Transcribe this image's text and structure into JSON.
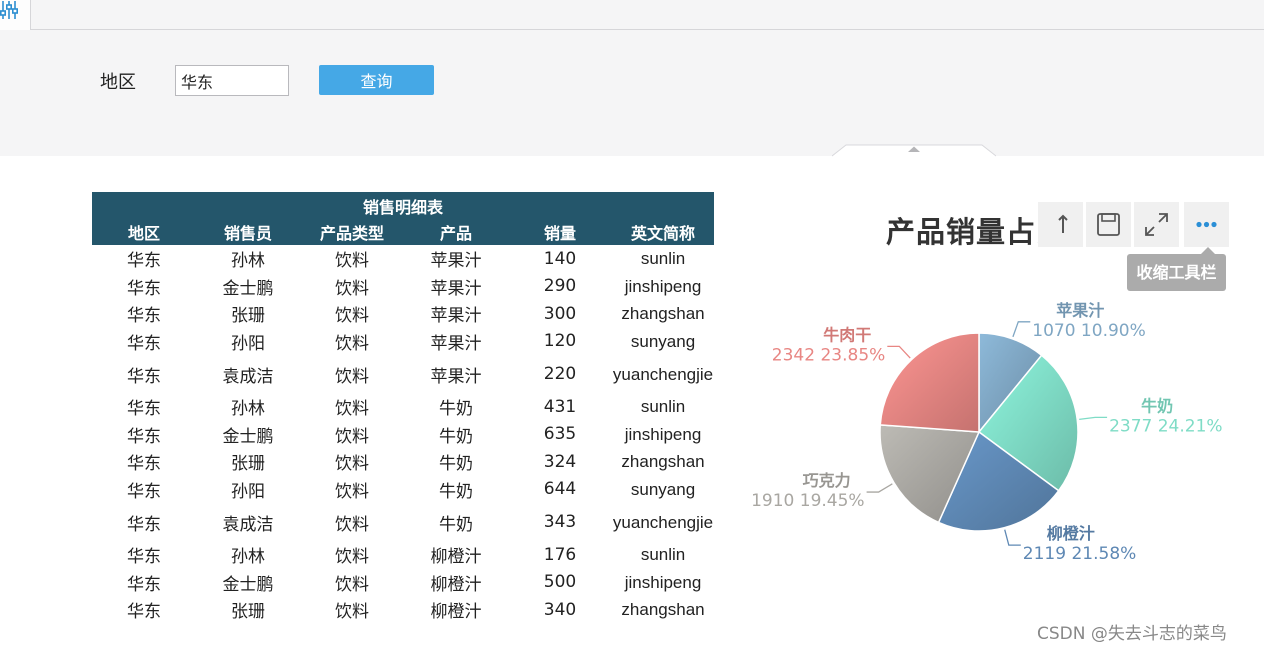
{
  "param": {
    "region_label": "地区",
    "region_value": "华东",
    "query_label": "查询"
  },
  "report": {
    "title": "销售明细表",
    "columns": [
      "地区",
      "销售员",
      "产品类型",
      "产品",
      "销量",
      "英文简称"
    ],
    "rows": [
      [
        "华东",
        "孙林",
        "饮料",
        "苹果汁",
        "140",
        "sunlin"
      ],
      [
        "华东",
        "金士鹏",
        "饮料",
        "苹果汁",
        "290",
        "jinshipeng"
      ],
      [
        "华东",
        "张珊",
        "饮料",
        "苹果汁",
        "300",
        "zhangshan"
      ],
      [
        "华东",
        "孙阳",
        "饮料",
        "苹果汁",
        "120",
        "sunyang"
      ],
      [
        "华东",
        "袁成洁",
        "饮料",
        "苹果汁",
        "220",
        "yuanchengjie"
      ],
      [
        "华东",
        "孙林",
        "饮料",
        "牛奶",
        "431",
        "sunlin"
      ],
      [
        "华东",
        "金士鹏",
        "饮料",
        "牛奶",
        "635",
        "jinshipeng"
      ],
      [
        "华东",
        "张珊",
        "饮料",
        "牛奶",
        "324",
        "zhangshan"
      ],
      [
        "华东",
        "孙阳",
        "饮料",
        "牛奶",
        "644",
        "sunyang"
      ],
      [
        "华东",
        "袁成洁",
        "饮料",
        "牛奶",
        "343",
        "yuanchengjie"
      ],
      [
        "华东",
        "孙林",
        "饮料",
        "柳橙汁",
        "176",
        "sunlin"
      ],
      [
        "华东",
        "金士鹏",
        "饮料",
        "柳橙汁",
        "500",
        "jinshipeng"
      ],
      [
        "华东",
        "张珊",
        "饮料",
        "柳橙汁",
        "340",
        "zhangshan"
      ]
    ]
  },
  "chart_toolbar": {
    "icons": [
      "refresh-icon",
      "save-icon",
      "expand-icon",
      "more-icon"
    ],
    "tooltip": "收缩工具栏"
  },
  "chart_data": {
    "type": "pie",
    "title": "产品销量占比",
    "slices": [
      {
        "name": "苹果汁",
        "value": 1070,
        "percent": "10.90%",
        "color": "#7fa6c3"
      },
      {
        "name": "牛奶",
        "value": 2377,
        "percent": "24.21%",
        "color": "#7fdcc6"
      },
      {
        "name": "柳橙汁",
        "value": 2119,
        "percent": "21.58%",
        "color": "#5e88b4"
      },
      {
        "name": "巧克力",
        "value": 1910,
        "percent": "19.45%",
        "color": "#a9a7a2"
      },
      {
        "name": "牛肉干",
        "value": 2342,
        "percent": "23.85%",
        "color": "#e88683"
      }
    ]
  },
  "watermark": "CSDN @失去斗志的菜鸟"
}
